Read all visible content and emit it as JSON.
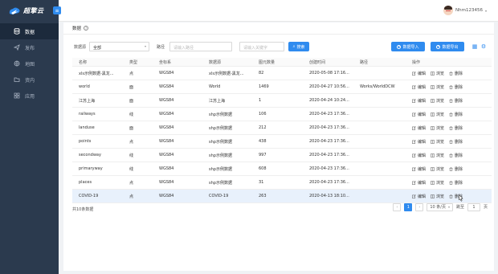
{
  "app": {
    "name": "超擎云",
    "collapse_glyph": "≡"
  },
  "header": {
    "username": "Nhm123456",
    "caret": "▾"
  },
  "sidebar": {
    "items": [
      {
        "label": "数据",
        "icon": "database-icon",
        "active": true
      },
      {
        "label": "发布",
        "icon": "send-icon",
        "active": false
      },
      {
        "label": "地图",
        "icon": "map-icon",
        "active": false
      },
      {
        "label": "资内",
        "icon": "folder-icon",
        "active": false
      },
      {
        "label": "应用",
        "icon": "apps-icon",
        "active": false
      }
    ]
  },
  "page": {
    "title": "数据",
    "help_glyph": "?"
  },
  "filters": {
    "source_label": "数据源",
    "source_value": "全部",
    "path_label": "路径",
    "path_placeholder": "请输入路径",
    "name_placeholder": "请输入关键字",
    "search_label": "搜索",
    "import_label": "数据导入",
    "export_label": "数据导出"
  },
  "table": {
    "columns": [
      "名称",
      "类型",
      "坐标系",
      "数据源",
      "图元数量",
      "创建时间",
      "路径",
      "操作"
    ],
    "rows": [
      [
        "xls示例数据-黑龙...",
        "点",
        "WGS84",
        "xls示例数据-黑龙...",
        "82",
        "2020-05-08 17:16...",
        ""
      ],
      [
        "world",
        "面",
        "WGS84",
        "World",
        "1469",
        "2020-04-27 10:56...",
        "Works/WorldDCW"
      ],
      [
        "江苏上海",
        "面",
        "WGS84",
        "江苏上海",
        "1",
        "2020-04-24 10:24...",
        ""
      ],
      [
        "railways",
        "线",
        "WGS84",
        "shp示例数据",
        "106",
        "2020-04-23 17:36...",
        ""
      ],
      [
        "landuse",
        "面",
        "WGS84",
        "shp示例数据",
        "212",
        "2020-04-23 17:36...",
        ""
      ],
      [
        "points",
        "点",
        "WGS84",
        "shp示例数据",
        "438",
        "2020-04-23 17:36...",
        ""
      ],
      [
        "secondway",
        "线",
        "WGS84",
        "shp示例数据",
        "997",
        "2020-04-23 17:36...",
        ""
      ],
      [
        "primaryway",
        "线",
        "WGS84",
        "shp示例数据",
        "608",
        "2020-04-23 17:36...",
        ""
      ],
      [
        "places",
        "点",
        "WGS84",
        "shp示例数据",
        "31",
        "2020-04-23 17:36...",
        ""
      ],
      [
        "COVID-19",
        "点",
        "WGS84",
        "COVID-19",
        "263",
        "2020-04-13 18:10...",
        ""
      ]
    ],
    "ops": {
      "edit": "编辑",
      "browse": "浏览",
      "delete": "删除"
    }
  },
  "footer": {
    "total": "共10条数据",
    "prev": "‹",
    "next": "›",
    "current_page": "1",
    "page_size": "10 条/页",
    "goto_label": "跳至",
    "goto_value": "1",
    "page_suffix": "页"
  },
  "colors": {
    "sidebar": "#2b3a4e",
    "primary": "#2f8bef",
    "active_nav": "#1c2a3c"
  }
}
